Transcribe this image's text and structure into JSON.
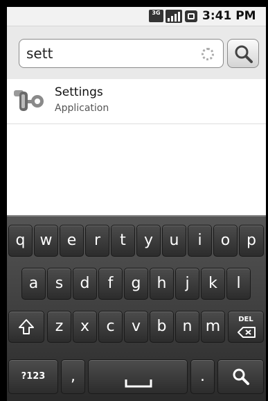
{
  "status_bar": {
    "network": "3G",
    "time": "3:41 PM"
  },
  "search": {
    "query": "sett",
    "search_button_icon": "magnifier-icon"
  },
  "results": [
    {
      "title": "Settings",
      "subtitle": "Application",
      "icon": "settings-wrench-icon"
    }
  ],
  "keyboard": {
    "row1": [
      "q",
      "w",
      "e",
      "r",
      "t",
      "y",
      "u",
      "i",
      "o",
      "p"
    ],
    "row2": [
      "a",
      "s",
      "d",
      "f",
      "g",
      "h",
      "j",
      "k",
      "l"
    ],
    "row3": [
      "z",
      "x",
      "c",
      "v",
      "b",
      "n",
      "m"
    ],
    "shift_icon": "shift-icon",
    "delete_label": "DEL",
    "symbols_label": "?123",
    "comma": ",",
    "period": ".",
    "space_icon": "space-bar-icon",
    "search_key_icon": "search-icon"
  },
  "colors": {
    "keyboard_bg": "#3a3a3a",
    "key_bg": "#3c3c3c",
    "key_text": "#ffffff"
  }
}
